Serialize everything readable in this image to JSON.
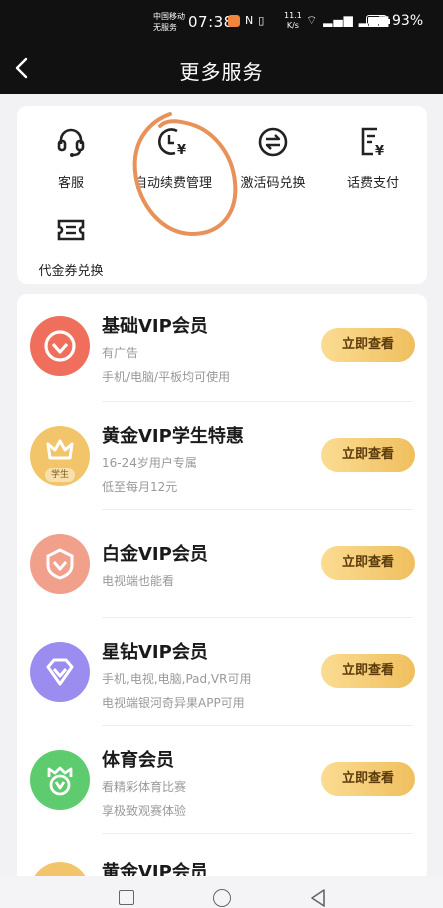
{
  "status_bar": {
    "carrier_line1": "中国移动",
    "carrier_line2": "无服务",
    "time": "07:38",
    "net_speed_value": "11.1",
    "net_speed_unit": "K/s",
    "battery": "93%"
  },
  "header": {
    "title": "更多服务"
  },
  "services": [
    {
      "label": "客服",
      "icon": "headset-icon"
    },
    {
      "label": "自动续费管理",
      "icon": "clock-yen-icon"
    },
    {
      "label": "激活码兑换",
      "icon": "exchange-icon"
    },
    {
      "label": "话费支付",
      "icon": "bill-yen-icon"
    },
    {
      "label": "代金券兑换",
      "icon": "voucher-icon"
    }
  ],
  "annotation": {
    "color": "#e8925a",
    "shape": "hand-drawn-circle"
  },
  "vip_products": [
    {
      "title": "基础VIP会员",
      "lines": [
        "有广告",
        "手机/电脑/平板均可使用"
      ],
      "button": "立即查看",
      "badge_color": "#ef6e5c",
      "badge_icon": "heart-shield-icon"
    },
    {
      "title": "黄金VIP学生特惠",
      "lines": [
        "16-24岁用户专属",
        "低至每月12元"
      ],
      "button": "立即查看",
      "badge_color": "#f2c56a",
      "badge_icon": "crown-icon",
      "badge_tag": "学生"
    },
    {
      "title": "白金VIP会员",
      "lines": [
        "电视端也能看"
      ],
      "button": "立即查看",
      "badge_color": "#f0a08b",
      "badge_icon": "heart-shield-icon"
    },
    {
      "title": "星钻VIP会员",
      "lines": [
        "手机,电视,电脑,Pad,VR可用",
        "电视端银河奇异果APP可用"
      ],
      "button": "立即查看",
      "badge_color": "#9b8cf0",
      "badge_icon": "diamond-icon"
    },
    {
      "title": "体育会员",
      "lines": [
        "看精彩体育比赛",
        "享极致观赛体验"
      ],
      "button": "立即查看",
      "badge_color": "#5ecb6e",
      "badge_icon": "crown-v-icon"
    },
    {
      "title": "黄金VIP会员",
      "lines": [],
      "button": "",
      "badge_color": "#f2c56a",
      "badge_icon": "crown-icon"
    }
  ]
}
